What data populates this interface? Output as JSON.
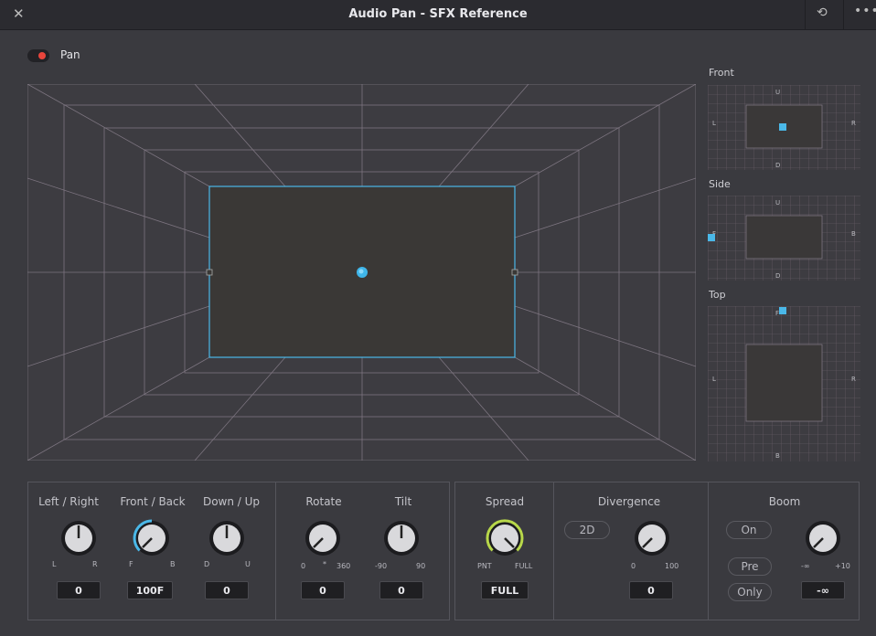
{
  "window": {
    "title": "Audio Pan - SFX Reference",
    "close_icon": "close-icon",
    "reset_icon": "reset-icon",
    "more_icon": "more-icon"
  },
  "pan": {
    "label": "Pan",
    "enabled": true,
    "toggle_color": "#e8453c"
  },
  "mini_views": {
    "front": {
      "label": "Front",
      "top": "U",
      "bottom": "D",
      "left": "L",
      "right": "R"
    },
    "side": {
      "label": "Side",
      "top": "U",
      "bottom": "D",
      "left": "F",
      "right": "B"
    },
    "top": {
      "label": "Top",
      "top": "F",
      "bottom": "B",
      "left": "L",
      "right": "R"
    }
  },
  "accent_color": "#4ab8e8",
  "knobs": {
    "left_right": {
      "label": "Left / Right",
      "min": "L",
      "max": "R",
      "value": "0"
    },
    "front_back": {
      "label": "Front / Back",
      "min": "F",
      "max": "B",
      "value": "100F"
    },
    "down_up": {
      "label": "Down / Up",
      "min": "D",
      "max": "U",
      "value": "0"
    },
    "rotate": {
      "label": "Rotate",
      "min": "0",
      "mid": "*",
      "max": "360",
      "value": "0"
    },
    "tilt": {
      "label": "Tilt",
      "min": "-90",
      "max": "90",
      "value": "0"
    },
    "spread": {
      "label": "Spread",
      "min": "PNT",
      "max": "FULL",
      "value": "FULL"
    },
    "divergence": {
      "label": "Divergence",
      "min": "0",
      "max": "100",
      "value": "0",
      "mode": "2D"
    },
    "boom": {
      "label": "Boom",
      "min": "-∞",
      "max": "+10",
      "value": "-∞",
      "on": "On",
      "pre": "Pre",
      "only": "Only"
    }
  }
}
